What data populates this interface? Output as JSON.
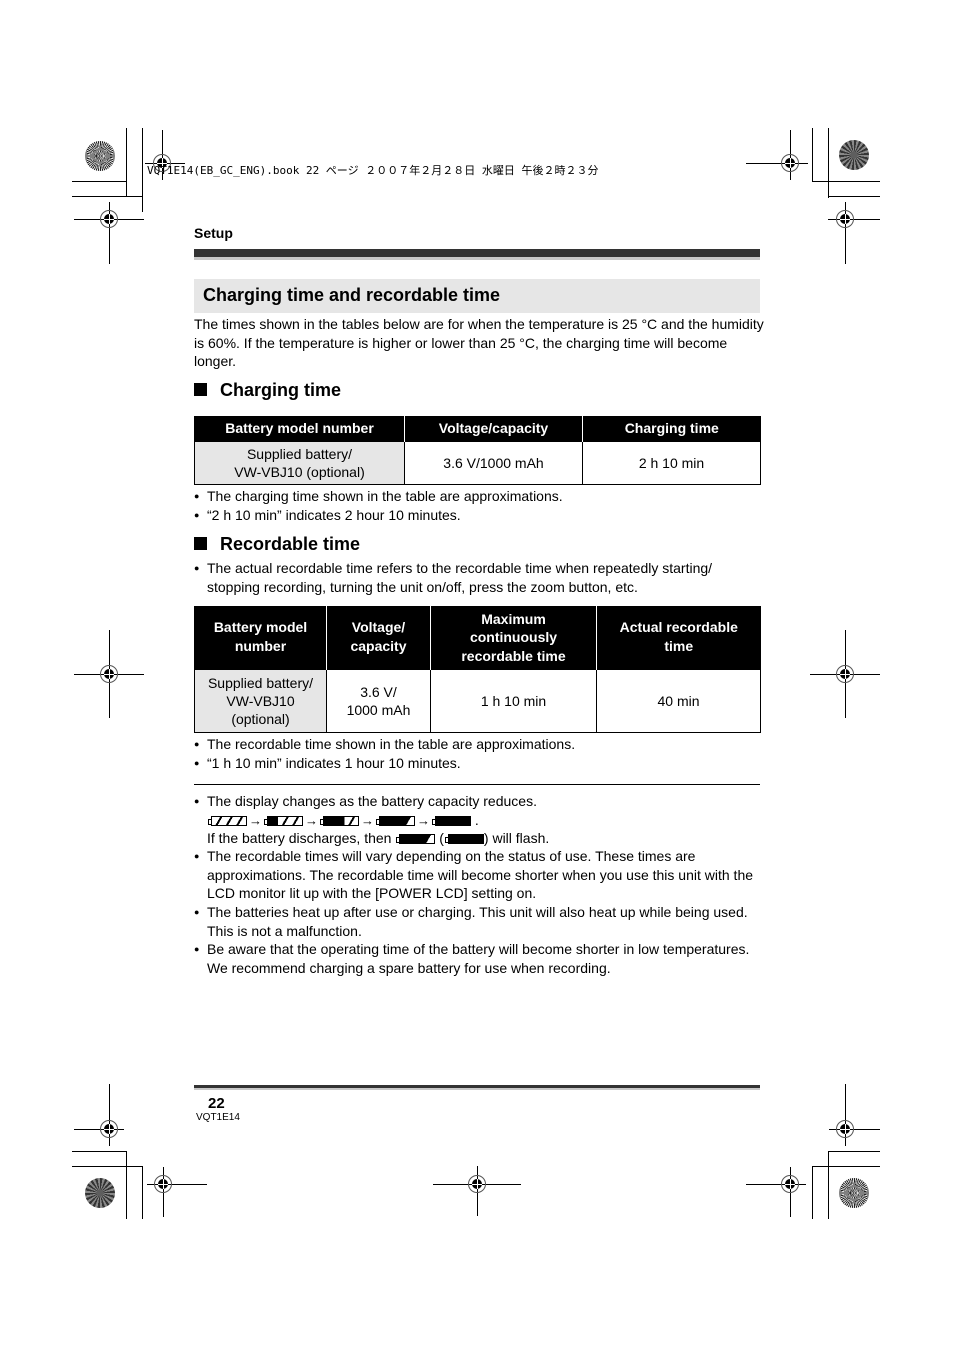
{
  "print_header": "VQT1E14(EB_GC_ENG).book  22 ページ  ２００７年２月２８日  水曜日  午後２時２３分",
  "section_label": "Setup",
  "title": "Charging time and recordable time",
  "intro": "The times shown in the tables below are for when the temperature is 25 °C and the humidity is 60%. If the temperature is higher or lower than 25 °C, the charging time will become longer.",
  "charging": {
    "heading": "Charging time",
    "table": {
      "headers": [
        "Battery model number",
        "Voltage/capacity",
        "Charging time"
      ],
      "rows": [
        {
          "model_line1": "Supplied battery/",
          "model_line2": "VW-VBJ10 (optional)",
          "voltage": "3.6 V/1000 mAh",
          "time": "2 h 10 min"
        }
      ]
    },
    "notes": [
      "The charging time shown in the table are approximations.",
      "“2 h 10 min” indicates 2 hour 10 minutes."
    ]
  },
  "recordable": {
    "heading": "Recordable time",
    "intro_note": "The actual recordable time refers to the recordable time when repeatedly starting/ stopping recording, turning the unit on/off, press the zoom button, etc.",
    "table": {
      "headers": [
        {
          "line1": "Battery model",
          "line2": "number",
          "line3": ""
        },
        {
          "line1": "Voltage/",
          "line2": "capacity",
          "line3": ""
        },
        {
          "line1": "Maximum",
          "line2": "continuously",
          "line3": "recordable time"
        },
        {
          "line1": "Actual recordable",
          "line2": "time",
          "line3": ""
        }
      ],
      "rows": [
        {
          "model_line1": "Supplied battery/",
          "model_line2": "VW-VBJ10",
          "model_line3": "(optional)",
          "voltage_line1": "3.6 V/",
          "voltage_line2": "1000 mAh",
          "max_time": "1 h 10 min",
          "actual_time": "40 min"
        }
      ]
    },
    "notes": [
      "The recordable time shown in the table are approximations.",
      "“1 h 10 min” indicates 1 hour 10 minutes."
    ]
  },
  "general_notes": {
    "display_change": "The display changes as the battery capacity reduces.",
    "battery_levels": [
      "battery-3-bars",
      "battery-2-bars",
      "battery-1-bar",
      "battery-low",
      "battery-empty"
    ],
    "arrow": "→",
    "period": ".",
    "discharge_prefix": "If the battery discharges, then",
    "discharge_open": "(",
    "discharge_suffix": ") will flash.",
    "items": [
      "The recordable times will vary depending on the status of use. These times are approximations. The recordable time will become shorter when you use this unit with the LCD monitor lit up with the [POWER LCD] setting on.",
      "The batteries heat up after use or charging. This unit will also heat up while being used. This is not a malfunction.",
      "Be aware that the operating time of the battery will become shorter in low temperatures. We recommend charging a spare battery for use when recording."
    ]
  },
  "footer": {
    "page_number": "22",
    "doc_code": "VQT1E14"
  }
}
